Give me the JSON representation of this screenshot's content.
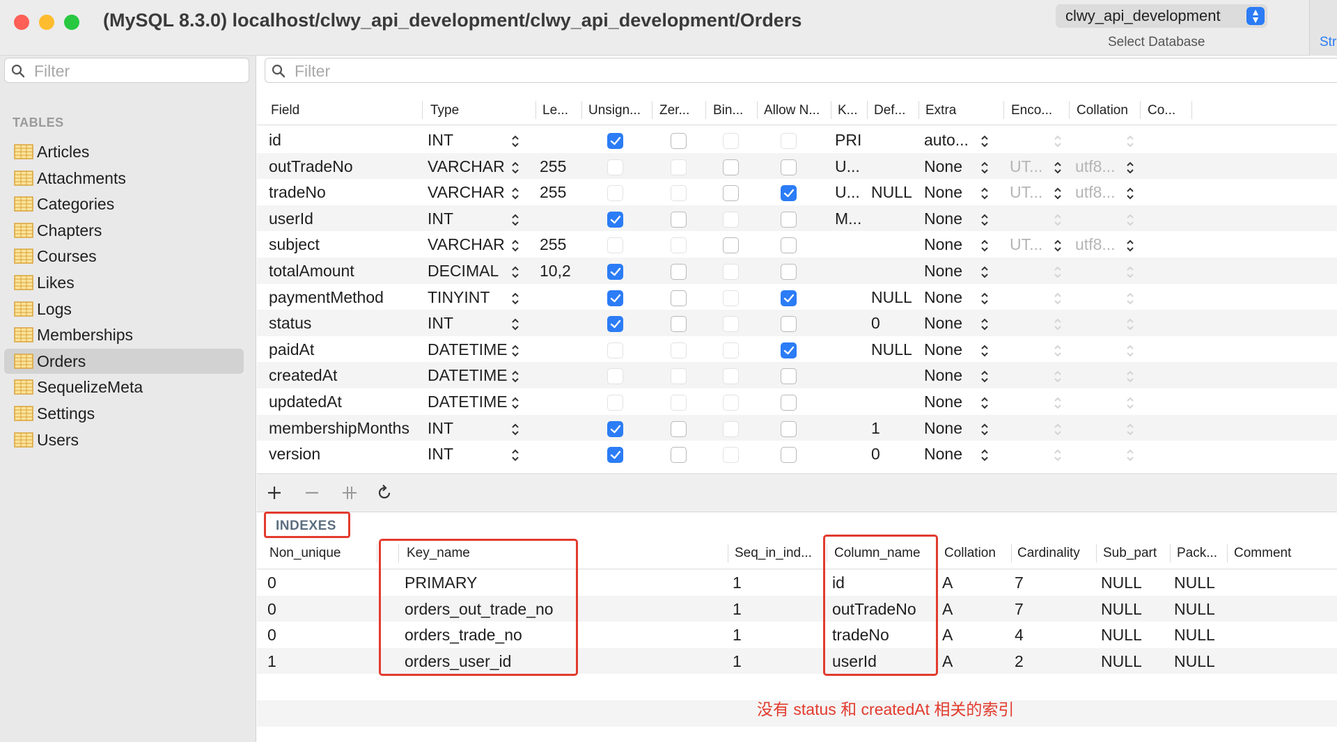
{
  "window": {
    "title": "(MySQL 8.3.0) localhost/clwy_api_development/clwy_api_development/Orders",
    "database_select_value": "clwy_api_development",
    "database_select_caption": "Select Database",
    "structure_tab_label": "Str"
  },
  "sidebar": {
    "filter_placeholder": "Filter",
    "tables_header": "TABLES",
    "items": [
      {
        "label": "Articles"
      },
      {
        "label": "Attachments"
      },
      {
        "label": "Categories"
      },
      {
        "label": "Chapters"
      },
      {
        "label": "Courses"
      },
      {
        "label": "Likes"
      },
      {
        "label": "Logs"
      },
      {
        "label": "Memberships"
      },
      {
        "label": "Orders",
        "selected": true
      },
      {
        "label": "SequelizeMeta"
      },
      {
        "label": "Settings"
      },
      {
        "label": "Users"
      }
    ]
  },
  "structure": {
    "filter_placeholder": "Filter",
    "columns": [
      "Field",
      "Type",
      "Le...",
      "Unsign...",
      "Zer...",
      "Bin...",
      "Allow N...",
      "K...",
      "Def...",
      "Extra",
      "Enco...",
      "Collation",
      "Co..."
    ],
    "rows": [
      {
        "field": "id",
        "type": "INT",
        "length": "",
        "unsigned": true,
        "zerofill": false,
        "binary": false,
        "allow_null": false,
        "key": "PRI",
        "default": "",
        "extra": "auto...",
        "encoding": "",
        "collation": ""
      },
      {
        "field": "outTradeNo",
        "type": "VARCHAR",
        "length": "255",
        "unsigned": false,
        "zerofill": false,
        "binary": false,
        "allow_null": false,
        "key": "U...",
        "default": "",
        "extra": "None",
        "encoding": "UT...",
        "collation": "utf8..."
      },
      {
        "field": "tradeNo",
        "type": "VARCHAR",
        "length": "255",
        "unsigned": false,
        "zerofill": false,
        "binary": false,
        "allow_null": true,
        "key": "U...",
        "default": "NULL",
        "extra": "None",
        "encoding": "UT...",
        "collation": "utf8..."
      },
      {
        "field": "userId",
        "type": "INT",
        "length": "",
        "unsigned": true,
        "zerofill": false,
        "binary": false,
        "allow_null": false,
        "key": "M...",
        "default": "",
        "extra": "None",
        "encoding": "",
        "collation": ""
      },
      {
        "field": "subject",
        "type": "VARCHAR",
        "length": "255",
        "unsigned": false,
        "zerofill": false,
        "binary": false,
        "allow_null": false,
        "key": "",
        "default": "",
        "extra": "None",
        "encoding": "UT...",
        "collation": "utf8..."
      },
      {
        "field": "totalAmount",
        "type": "DECIMAL",
        "length": "10,2",
        "unsigned": true,
        "zerofill": false,
        "binary": false,
        "allow_null": false,
        "key": "",
        "default": "",
        "extra": "None",
        "encoding": "",
        "collation": ""
      },
      {
        "field": "paymentMethod",
        "type": "TINYINT",
        "length": "",
        "unsigned": true,
        "zerofill": false,
        "binary": false,
        "allow_null": true,
        "key": "",
        "default": "NULL",
        "extra": "None",
        "encoding": "",
        "collation": ""
      },
      {
        "field": "status",
        "type": "INT",
        "length": "",
        "unsigned": true,
        "zerofill": false,
        "binary": false,
        "allow_null": false,
        "key": "",
        "default": "0",
        "extra": "None",
        "encoding": "",
        "collation": ""
      },
      {
        "field": "paidAt",
        "type": "DATETIME",
        "length": "",
        "unsigned": false,
        "zerofill": false,
        "binary": false,
        "allow_null": true,
        "key": "",
        "default": "NULL",
        "extra": "None",
        "encoding": "",
        "collation": ""
      },
      {
        "field": "createdAt",
        "type": "DATETIME",
        "length": "",
        "unsigned": false,
        "zerofill": false,
        "binary": false,
        "allow_null": false,
        "key": "",
        "default": "",
        "extra": "None",
        "encoding": "",
        "collation": ""
      },
      {
        "field": "updatedAt",
        "type": "DATETIME",
        "length": "",
        "unsigned": false,
        "zerofill": false,
        "binary": false,
        "allow_null": false,
        "key": "",
        "default": "",
        "extra": "None",
        "encoding": "",
        "collation": ""
      },
      {
        "field": "membershipMonths",
        "type": "INT",
        "length": "",
        "unsigned": true,
        "zerofill": false,
        "binary": false,
        "allow_null": false,
        "key": "",
        "default": "1",
        "extra": "None",
        "encoding": "",
        "collation": ""
      },
      {
        "field": "version",
        "type": "INT",
        "length": "",
        "unsigned": true,
        "zerofill": false,
        "binary": false,
        "allow_null": false,
        "key": "",
        "default": "0",
        "extra": "None",
        "encoding": "",
        "collation": ""
      }
    ]
  },
  "toolbar": {
    "icons": [
      "add-icon",
      "remove-icon",
      "duplicate-icon",
      "refresh-icon"
    ]
  },
  "indexes": {
    "label": "INDEXES",
    "columns": [
      "Non_unique",
      "Key_name",
      "Seq_in_ind...",
      "Column_name",
      "Collation",
      "Cardinality",
      "Sub_part",
      "Pack...",
      "Comment"
    ],
    "rows": [
      {
        "non_unique": "0",
        "key_name": "PRIMARY",
        "seq": "1",
        "column_name": "id",
        "collation": "A",
        "cardinality": "7",
        "sub_part": "NULL",
        "packed": "NULL",
        "comment": ""
      },
      {
        "non_unique": "0",
        "key_name": "orders_out_trade_no",
        "seq": "1",
        "column_name": "outTradeNo",
        "collation": "A",
        "cardinality": "7",
        "sub_part": "NULL",
        "packed": "NULL",
        "comment": ""
      },
      {
        "non_unique": "0",
        "key_name": "orders_trade_no",
        "seq": "1",
        "column_name": "tradeNo",
        "collation": "A",
        "cardinality": "4",
        "sub_part": "NULL",
        "packed": "NULL",
        "comment": ""
      },
      {
        "non_unique": "1",
        "key_name": "orders_user_id",
        "seq": "1",
        "column_name": "userId",
        "collation": "A",
        "cardinality": "2",
        "sub_part": "NULL",
        "packed": "NULL",
        "comment": ""
      }
    ]
  },
  "annotation": {
    "note": "没有 status 和 createdAt 相关的索引"
  },
  "colors": {
    "accent": "#2b7cf6",
    "annotation_red": "#e23b2e",
    "traffic_close": "#fe5f57",
    "traffic_min": "#febc2e",
    "traffic_max": "#28c840"
  }
}
